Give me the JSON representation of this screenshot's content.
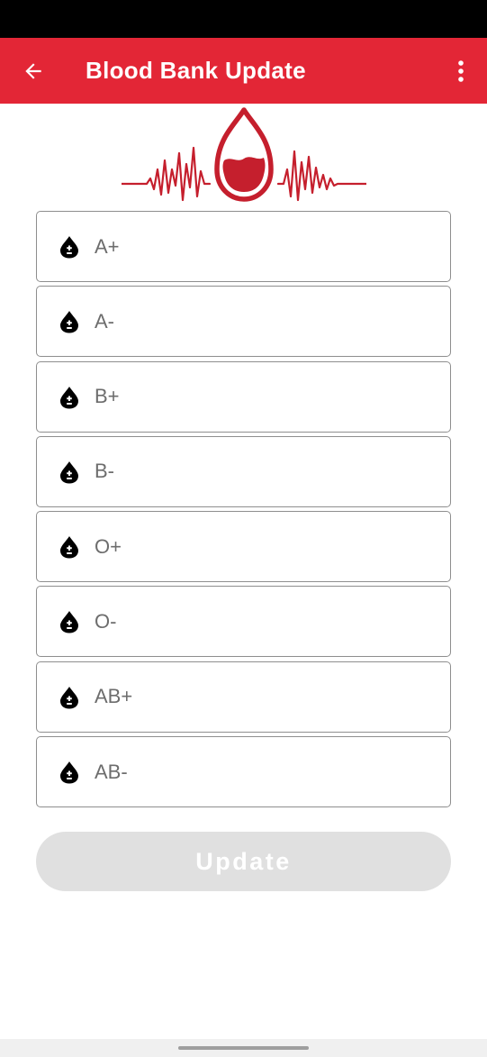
{
  "colors": {
    "app_bar": "#e32636",
    "logo": "#c51f2d",
    "button_disabled": "#e0e0e0"
  },
  "app_bar": {
    "title": "Blood Bank Update",
    "back_icon": "arrow-back-icon",
    "menu_icon": "more-vertical-icon"
  },
  "logo": {
    "icon": "blood-drop-heartbeat-logo"
  },
  "fields": [
    {
      "placeholder": "A+",
      "value": "",
      "icon": "blood-drop-plus-minus-icon"
    },
    {
      "placeholder": "A-",
      "value": "",
      "icon": "blood-drop-plus-minus-icon"
    },
    {
      "placeholder": "B+",
      "value": "",
      "icon": "blood-drop-plus-minus-icon"
    },
    {
      "placeholder": "B-",
      "value": "",
      "icon": "blood-drop-plus-minus-icon"
    },
    {
      "placeholder": "O+",
      "value": "",
      "icon": "blood-drop-plus-minus-icon"
    },
    {
      "placeholder": "O-",
      "value": "",
      "icon": "blood-drop-plus-minus-icon"
    },
    {
      "placeholder": "AB+",
      "value": "",
      "icon": "blood-drop-plus-minus-icon"
    },
    {
      "placeholder": "AB-",
      "value": "",
      "icon": "blood-drop-plus-minus-icon"
    }
  ],
  "update_button": {
    "label": "Update",
    "enabled": false
  }
}
